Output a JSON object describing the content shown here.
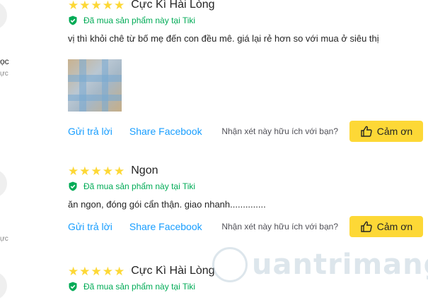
{
  "left_rail": {
    "snippet_1": "ọc",
    "snippet_1_sub": "ực",
    "snippet_2_sub": "ực"
  },
  "reviews": [
    {
      "rating": 5,
      "title": "Cực Kì Hài Lòng",
      "verified_label": "Đã mua sản phẩm này tại Tiki",
      "content": "vị thì khỏi chê từ bố mẹ đến con đều mê. giá lại rẻ hơn so với mua ở siêu thị",
      "has_photo": true
    },
    {
      "rating": 5,
      "title": "Ngon",
      "verified_label": "Đã mua sản phẩm này tại Tiki",
      "content": "ăn ngon, đóng gói cẩn thận. giao nhanh..............",
      "has_photo": false
    },
    {
      "rating": 5,
      "title": "Cực Kì Hài Lòng",
      "verified_label": "Đã mua sản phẩm này tại Tiki"
    }
  ],
  "actions": {
    "reply_label": "Gửi trả lời",
    "share_label": "Share Facebook",
    "helpful_question": "Nhận xét này hữu ích với bạn?",
    "thanks_label": "Cảm ơn"
  },
  "watermark": {
    "text": "uantrimang"
  },
  "colors": {
    "star": "#fdd836",
    "verified": "#00ab56",
    "link": "#189eff",
    "button": "#fdd836"
  },
  "icons": {
    "star": "star-icon",
    "verified": "shield-check-icon",
    "thanks": "thumbs-up-icon"
  }
}
